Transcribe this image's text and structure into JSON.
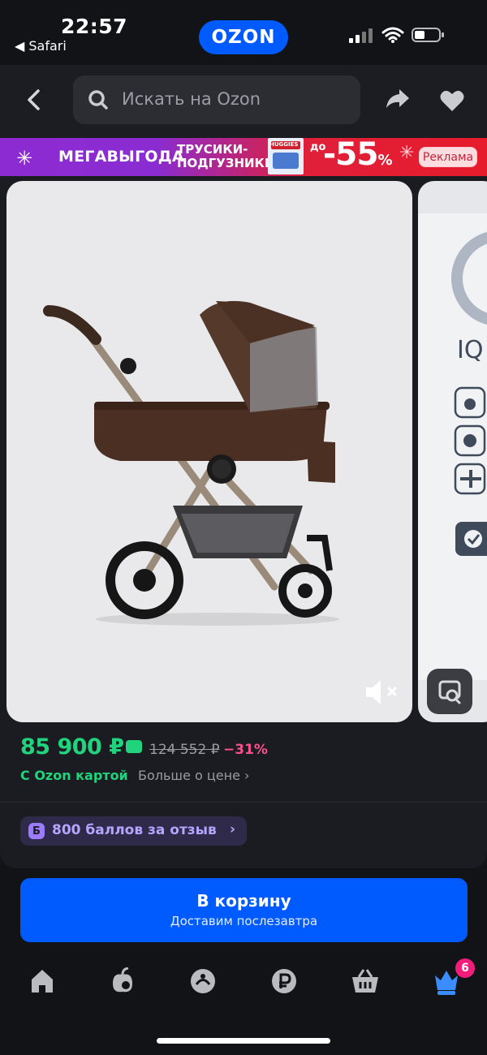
{
  "status_bar": {
    "time": "22:57",
    "back_app": "◀ Safari",
    "brand": "OZON"
  },
  "header": {
    "search_placeholder": "Искать на Ozon"
  },
  "promo": {
    "title": "МЕГАВЫГОДА",
    "subtitle": "ТРУСИКИ-ПОДГУЗНИКИ",
    "pack_brand": "HUGGIES",
    "upto": "до",
    "discount": "-55",
    "percent": "%",
    "ad_label": "Реклама",
    "colors": {
      "left": "#8d2bd2",
      "right": "#e61b2b"
    }
  },
  "gallery": {
    "images": [
      "stroller-photo",
      "feature-infographic"
    ],
    "second_image_text": "IQ"
  },
  "price": {
    "current": "85 900 ₽",
    "old": "124 552 ₽",
    "discount": "−31%",
    "ozon_card_label": "С Ozon картой",
    "more_price_label": "Больше о цене",
    "more_price_arrow": "›"
  },
  "bonus": {
    "badge": "Б",
    "label": "800 баллов за отзыв",
    "arrow": "›"
  },
  "cart": {
    "title": "В корзину",
    "subtitle": "Доставим послезавтра"
  },
  "bottom_nav": {
    "items": [
      "home-icon",
      "fresh-icon",
      "catalog-icon",
      "finance-icon",
      "cart-icon",
      "profile-icon"
    ],
    "badge_count": "6"
  },
  "colors": {
    "accent": "#005bff",
    "price_green": "#22d37d",
    "discount_pink": "#ff4f8a",
    "bg": "#121317"
  }
}
